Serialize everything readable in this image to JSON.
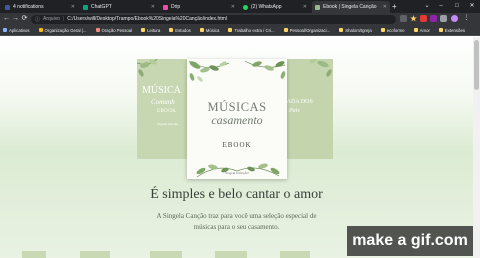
{
  "tabs": [
    {
      "title": "4 notifications",
      "color": "#3b5998"
    },
    {
      "title": "ChatGPT",
      "color": "#10a37f"
    },
    {
      "title": "Drip",
      "color": "#e94fa7"
    },
    {
      "title": "(2) WhatsApp",
      "color": "#25d366"
    },
    {
      "title": "Ebook | Singela Canção",
      "color": "#9ab88a"
    }
  ],
  "toolbar": {
    "protocol_label": "Arquivo",
    "url": "C:/Users/will/Desktop/Trampo/Ebook%20Singela%20Canção/index.html",
    "back": "←",
    "forward": "→",
    "reload": "⟳",
    "new_tab": "+",
    "minimize": "–",
    "maximize": "□",
    "close": "✕"
  },
  "bookmarks": [
    {
      "label": "Aplicativos",
      "color": "#8ab4f8"
    },
    {
      "label": "Organização Geral |...",
      "color": "#fbbc04"
    },
    {
      "label": "Oração Pessoal",
      "color": "#f28b82"
    },
    {
      "label": "Leitura",
      "color": "#fdd663"
    },
    {
      "label": "Estudos",
      "color": "#fdd663"
    },
    {
      "label": "Música",
      "color": "#fdd663"
    },
    {
      "label": "Trabalho extra / Cri...",
      "color": "#fdd663"
    },
    {
      "label": "Pessoal/Organizaci...",
      "color": "#fdd663"
    },
    {
      "label": "Shalom/Igreja",
      "color": "#fdd663"
    },
    {
      "label": "ecoforme",
      "color": "#fdd663"
    },
    {
      "label": "Amor",
      "color": "#fdd663"
    },
    {
      "label": "Extensões",
      "color": "#fdd663"
    }
  ],
  "books": {
    "left": {
      "title": "MÚSICA",
      "subtitle": "Comunh",
      "label": "EBOOK",
      "small": "Singela Canção"
    },
    "center": {
      "title": "MÚSICAS",
      "subtitle": "casamento",
      "label": "EBOOK",
      "brand": "Singela CANÇÃO"
    },
    "right": {
      "title": "TRADA DOS",
      "subtitle": "Pais"
    }
  },
  "hero": {
    "headline": "É simples e belo cantar o amor",
    "description": "A Singela Canção traz para você uma seleção especial de músicas para o seu casamento."
  },
  "watermark": {
    "text": "make a gif.com"
  }
}
